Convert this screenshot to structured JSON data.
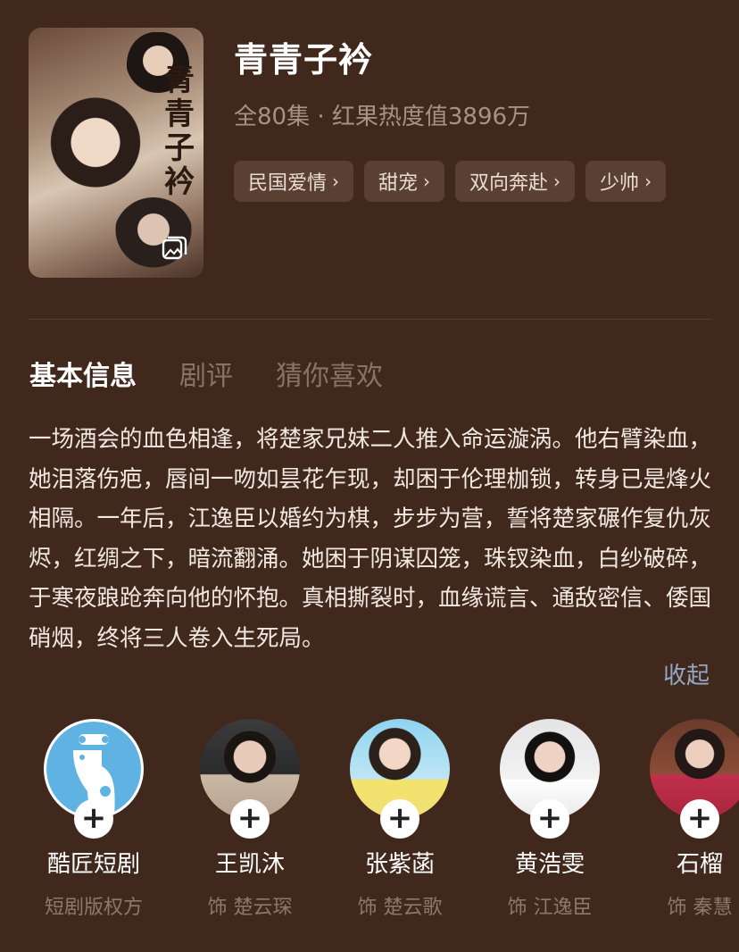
{
  "drama": {
    "title": "青青子衿",
    "meta": "全80集 · 红果热度值3896万",
    "poster_calligraphy": "青青子衿",
    "tags": [
      "民国爱情",
      "甜宠",
      "双向奔赴",
      "少帅"
    ]
  },
  "tabs": [
    "基本信息",
    "剧评",
    "猜你喜欢"
  ],
  "description": "一场酒会的血色相逢，将楚家兄妹二人推入命运漩涡。他右臂染血，她泪落伤疤，唇间一吻如昙花乍现，却困于伦理枷锁，转身已是烽火相隔。一年后，江逸臣以婚约为棋，步步为营，誓将楚家碾作复仇灰烬，红绸之下，暗流翻涌。她困于阴谋囚笼，珠钗染血，白纱破碎，于寒夜踉跄奔向他的怀抱。真相撕裂时，血缘谎言、通敌密信、倭国硝烟，终将三人卷入生死局。",
  "collapse_label": "收起",
  "cast": [
    {
      "name": "酷匠短剧",
      "role": "短剧版权方"
    },
    {
      "name": "王凯沐",
      "role": "饰 楚云琛"
    },
    {
      "name": "张紫菡",
      "role": "饰 楚云歌"
    },
    {
      "name": "黄浩雯",
      "role": "饰 江逸臣"
    },
    {
      "name": "石榴",
      "role": "饰 秦慧"
    }
  ],
  "colors": {
    "background": "#40281c",
    "tag_bg": "#5a4033",
    "link": "#94a8c6"
  }
}
